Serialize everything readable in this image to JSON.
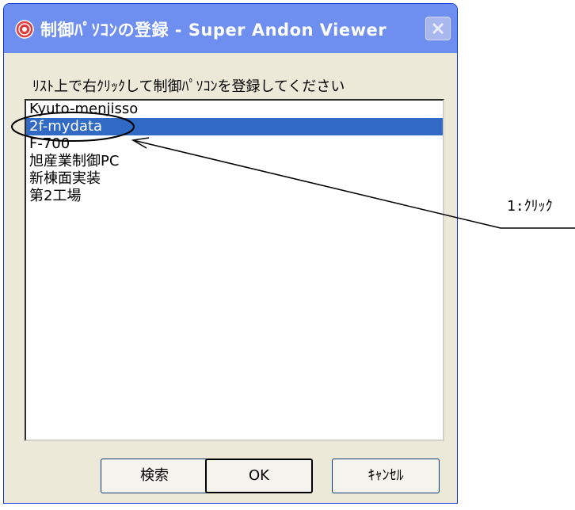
{
  "window": {
    "title": "制御ﾊﾟｿｺﾝの登録 - Super Andon Viewer",
    "icon": "app-logo-icon",
    "close_icon": "close-icon"
  },
  "instruction": "ﾘｽﾄ上で右ｸﾘｯｸして制御ﾊﾟｿｺﾝを登録してください",
  "list": {
    "items": [
      {
        "label": "Kyuto-menjisso",
        "selected": false
      },
      {
        "label": "2f-mydata",
        "selected": true
      },
      {
        "label": "F-700",
        "selected": false
      },
      {
        "label": "旭産業制御PC",
        "selected": false
      },
      {
        "label": "新棟面実装",
        "selected": false
      },
      {
        "label": "第2工場",
        "selected": false
      }
    ]
  },
  "buttons": {
    "search": "検索",
    "ok": "OK",
    "cancel": "ｷｬﾝｾﾙ"
  },
  "annotation": {
    "label": "1:ｸﾘｯｸ"
  },
  "colors": {
    "titlebar": "#6f8ff0",
    "selection": "#316ac5",
    "dialog_bg": "#ece9d8"
  }
}
